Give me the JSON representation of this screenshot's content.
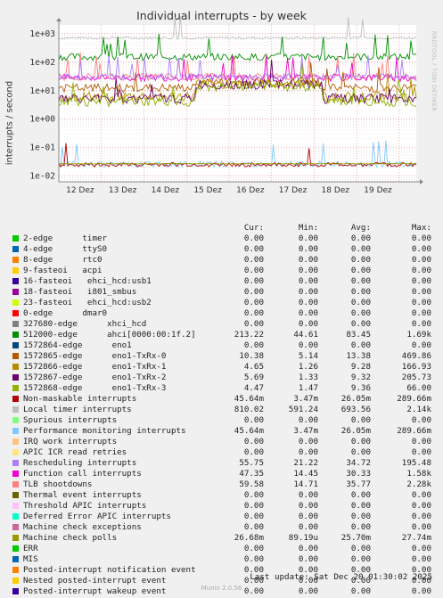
{
  "page": {
    "side_text": "RRDTOOL / TOBI OETIKER",
    "footer": "Munin 2.0.56",
    "last_update": "Last update: Sat Dec 20 01:30:02 2025"
  },
  "chart_data": {
    "type": "line",
    "title": "Individual interrupts - by week",
    "ylabel": "interrupts / second",
    "yscale": "log",
    "ylim": [
      0.006,
      2000
    ],
    "yticks": [
      0.01,
      0.1,
      1,
      10,
      100,
      1000
    ],
    "ytick_labels": [
      "1e-02",
      "1e-01",
      "1e+00",
      "1e+01",
      "1e+02",
      "1e+03"
    ],
    "xlim": [
      0,
      8.4
    ],
    "x_categories": [
      "12 Dez",
      "13 Dez",
      "14 Dez",
      "15 Dez",
      "16 Dez",
      "17 Dez",
      "18 Dez",
      "19 Dez"
    ],
    "x_category_positions": [
      0.5,
      1.5,
      2.5,
      3.5,
      4.5,
      5.5,
      6.5,
      7.5
    ],
    "grid": true,
    "legend_columns": [
      "Cur:",
      "Min:",
      "Avg:",
      "Max:"
    ],
    "series": [
      {
        "name": "2-edge      timer",
        "color": "#00cc00",
        "cur": "0.00",
        "min": "0.00",
        "avg": "0.00",
        "max": "0.00"
      },
      {
        "name": "4-edge      ttyS0",
        "color": "#0066b3",
        "cur": "0.00",
        "min": "0.00",
        "avg": "0.00",
        "max": "0.00"
      },
      {
        "name": "8-edge      rtc0",
        "color": "#ff8000",
        "cur": "0.00",
        "min": "0.00",
        "avg": "0.00",
        "max": "0.00"
      },
      {
        "name": "9-fasteoi   acpi",
        "color": "#ffcc00",
        "cur": "0.00",
        "min": "0.00",
        "avg": "0.00",
        "max": "0.00"
      },
      {
        "name": "16-fasteoi   ehci_hcd:usb1",
        "color": "#330099",
        "cur": "0.00",
        "min": "0.00",
        "avg": "0.00",
        "max": "0.00"
      },
      {
        "name": "18-fasteoi   i801_smbus",
        "color": "#990099",
        "cur": "0.00",
        "min": "0.00",
        "avg": "0.00",
        "max": "0.00"
      },
      {
        "name": "23-fasteoi   ehci_hcd:usb2",
        "color": "#ccff00",
        "cur": "0.00",
        "min": "0.00",
        "avg": "0.00",
        "max": "0.00"
      },
      {
        "name": "0-edge      dmar0",
        "color": "#ff0000",
        "cur": "0.00",
        "min": "0.00",
        "avg": "0.00",
        "max": "0.00"
      },
      {
        "name": "327680-edge      xhci_hcd",
        "color": "#808080",
        "cur": "0.00",
        "min": "0.00",
        "avg": "0.00",
        "max": "0.00"
      },
      {
        "name": "512000-edge      ahci[0000:00:1f.2]",
        "color": "#008f00",
        "cur": "213.22",
        "min": "44.61",
        "avg": "83.45",
        "max": "1.69k"
      },
      {
        "name": "1572864-edge      eno1",
        "color": "#00487d",
        "cur": "0.00",
        "min": "0.00",
        "avg": "0.00",
        "max": "0.00"
      },
      {
        "name": "1572865-edge      eno1-TxRx-0",
        "color": "#b35a00",
        "cur": "10.38",
        "min": "5.14",
        "avg": "13.38",
        "max": "469.86"
      },
      {
        "name": "1572866-edge      eno1-TxRx-1",
        "color": "#b38f00",
        "cur": "4.65",
        "min": "1.26",
        "avg": "9.28",
        "max": "166.93"
      },
      {
        "name": "1572867-edge      eno1-TxRx-2",
        "color": "#6b006b",
        "cur": "5.69",
        "min": "1.33",
        "avg": "9.32",
        "max": "205.73"
      },
      {
        "name": "1572868-edge      eno1-TxRx-3",
        "color": "#8fb300",
        "cur": "4.47",
        "min": "1.47",
        "avg": "9.36",
        "max": "66.00"
      },
      {
        "name": "Non-maskable interrupts",
        "color": "#b30000",
        "cur": "45.64m",
        "min": "3.47m",
        "avg": "26.05m",
        "max": "289.66m"
      },
      {
        "name": "Local timer interrupts",
        "color": "#bebebe",
        "cur": "810.02",
        "min": "591.24",
        "avg": "693.56",
        "max": "2.14k"
      },
      {
        "name": "Spurious interrupts",
        "color": "#80ff80",
        "cur": "0.00",
        "min": "0.00",
        "avg": "0.00",
        "max": "0.00"
      },
      {
        "name": "Performance monitoring interrupts",
        "color": "#80c9ff",
        "cur": "45.64m",
        "min": "3.47m",
        "avg": "26.05m",
        "max": "289.66m"
      },
      {
        "name": "IRQ work interrupts",
        "color": "#ffc080",
        "cur": "0.00",
        "min": "0.00",
        "avg": "0.00",
        "max": "0.00"
      },
      {
        "name": "APIC ICR read retries",
        "color": "#ffe680",
        "cur": "0.00",
        "min": "0.00",
        "avg": "0.00",
        "max": "0.00"
      },
      {
        "name": "Rescheduling interrupts",
        "color": "#aa80ff",
        "cur": "55.75",
        "min": "21.22",
        "avg": "34.72",
        "max": "195.48"
      },
      {
        "name": "Function call interrupts",
        "color": "#ee00cc",
        "cur": "47.35",
        "min": "14.45",
        "avg": "30.33",
        "max": "1.58k"
      },
      {
        "name": "TLB shootdowns",
        "color": "#ff8080",
        "cur": "59.58",
        "min": "14.71",
        "avg": "35.77",
        "max": "2.28k"
      },
      {
        "name": "Thermal event interrupts",
        "color": "#666600",
        "cur": "0.00",
        "min": "0.00",
        "avg": "0.00",
        "max": "0.00"
      },
      {
        "name": "Threshold APIC interrupts",
        "color": "#ffbfff",
        "cur": "0.00",
        "min": "0.00",
        "avg": "0.00",
        "max": "0.00"
      },
      {
        "name": "Deferred Error APIC interrupts",
        "color": "#00ffcc",
        "cur": "0.00",
        "min": "0.00",
        "avg": "0.00",
        "max": "0.00"
      },
      {
        "name": "Machine check exceptions",
        "color": "#cc6699",
        "cur": "0.00",
        "min": "0.00",
        "avg": "0.00",
        "max": "0.00"
      },
      {
        "name": "Machine check polls",
        "color": "#999900",
        "cur": "26.68m",
        "min": "89.19u",
        "avg": "25.70m",
        "max": "27.74m"
      },
      {
        "name": "ERR",
        "color": "#00cc00",
        "cur": "0.00",
        "min": "0.00",
        "avg": "0.00",
        "max": "0.00"
      },
      {
        "name": "MIS",
        "color": "#0066b3",
        "cur": "0.00",
        "min": "0.00",
        "avg": "0.00",
        "max": "0.00"
      },
      {
        "name": "Posted-interrupt notification event",
        "color": "#ff8000",
        "cur": "0.00",
        "min": "0.00",
        "avg": "0.00",
        "max": "0.00"
      },
      {
        "name": "Nested posted-interrupt event",
        "color": "#ffcc00",
        "cur": "0.00",
        "min": "0.00",
        "avg": "0.00",
        "max": "0.00"
      },
      {
        "name": "Posted-interrupt wakeup event",
        "color": "#330099",
        "cur": "0.00",
        "min": "0.00",
        "avg": "0.00",
        "max": "0.00"
      }
    ]
  }
}
